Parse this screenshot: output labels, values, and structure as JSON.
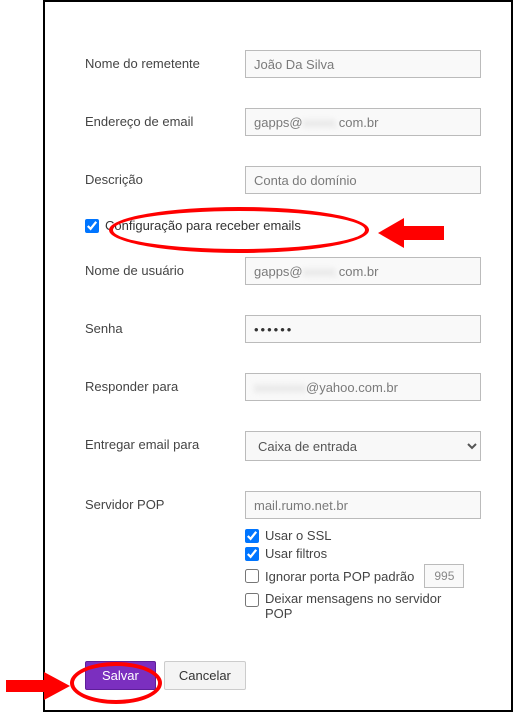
{
  "labels": {
    "sender_name": "Nome do remetente",
    "email_address": "Endereço de email",
    "description": "Descrição",
    "receive_config": "Configuração para receber emails",
    "username": "Nome de usuário",
    "password": "Senha",
    "reply_to": "Responder para",
    "deliver_to": "Entregar email para",
    "pop_server": "Servidor POP",
    "use_ssl": "Usar o SSL",
    "use_filters": "Usar filtros",
    "ignore_default_port": "Ignorar porta POP padrão",
    "leave_on_server": "Deixar mensagens no servidor POP"
  },
  "values": {
    "sender_name": "João Da Silva",
    "email_address_prefix": "gapps@",
    "email_address_suffix": "com.br",
    "description": "Conta do domínio",
    "username_prefix": "gapps@",
    "username_suffix": "com.br",
    "password": "••••••",
    "reply_to_suffix": "@yahoo.com.br",
    "deliver_to": "Caixa de entrada",
    "pop_server": "mail.rumo.net.br",
    "default_port": "995"
  },
  "buttons": {
    "save": "Salvar",
    "cancel": "Cancelar"
  }
}
